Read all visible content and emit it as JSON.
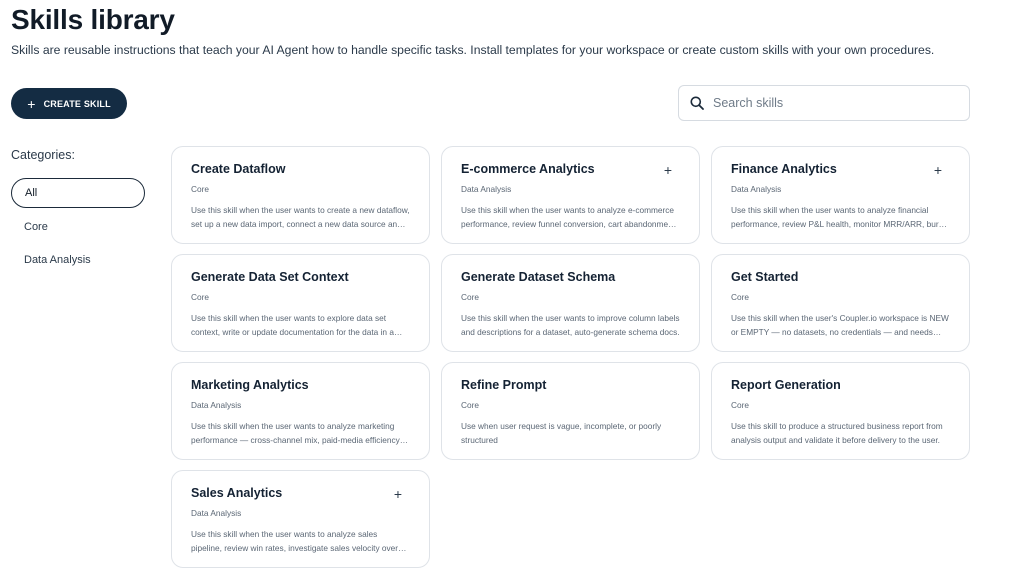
{
  "header": {
    "title": "Skills library",
    "subtitle": "Skills are reusable instructions that teach your AI Agent how to handle specific tasks. Install templates for your workspace or create custom skills with your own procedures."
  },
  "toolbar": {
    "create_label": "CREATE SKILL",
    "create_icon": "plus-icon"
  },
  "search": {
    "placeholder": "Search skills",
    "value": "",
    "icon": "search-icon"
  },
  "categories": {
    "label": "Categories:",
    "items": [
      {
        "label": "All",
        "active": true
      },
      {
        "label": "Core",
        "active": false
      },
      {
        "label": "Data Analysis",
        "active": false
      }
    ]
  },
  "skills": [
    {
      "title": "Create Dataflow",
      "category": "Core",
      "description": "Use this skill when the user wants to create a new dataflow, set up a new data import, connect a new data source and configure scheduling.",
      "addable": false
    },
    {
      "title": "E-commerce Analytics",
      "category": "Data Analysis",
      "description": "Use this skill when the user wants to analyze e-commerce performance, review funnel conversion, cart abandonment and revenue.",
      "addable": true
    },
    {
      "title": "Finance Analytics",
      "category": "Data Analysis",
      "description": "Use this skill when the user wants to analyze financial performance, review P&L health, monitor MRR/ARR, burn and runway.",
      "addable": true
    },
    {
      "title": "Generate Data Set Context",
      "category": "Core",
      "description": "Use this skill when the user wants to explore data set context, write or update documentation for the data in a dataset.",
      "addable": false
    },
    {
      "title": "Generate Dataset Schema",
      "category": "Core",
      "description": "Use this skill when the user wants to improve column labels and descriptions for a dataset, auto-generate schema docs.",
      "addable": false
    },
    {
      "title": "Get Started",
      "category": "Core",
      "description": "Use this skill when the user's Coupler.io workspace is NEW or EMPTY — no datasets, no credentials — and needs onboarding.",
      "addable": false
    },
    {
      "title": "Marketing Analytics",
      "category": "Data Analysis",
      "description": "Use this skill when the user wants to analyze marketing performance — cross-channel mix, paid-media efficiency and ROAS.",
      "addable": true
    },
    {
      "title": "Refine Prompt",
      "category": "Core",
      "description": "Use when user request is vague, incomplete, or poorly structured",
      "addable": false
    },
    {
      "title": "Report Generation",
      "category": "Core",
      "description": "Use this skill to produce a structured business report from analysis output and validate it before delivery to the user.",
      "addable": false
    },
    {
      "title": "Sales Analytics",
      "category": "Data Analysis",
      "description": "Use this skill when the user wants to analyze sales pipeline, review win rates, investigate sales velocity over time.",
      "addable": true
    }
  ],
  "colors": {
    "primary": "#142c43",
    "border": "#dfe3e8",
    "text": "#142233",
    "muted": "#5b6775"
  }
}
